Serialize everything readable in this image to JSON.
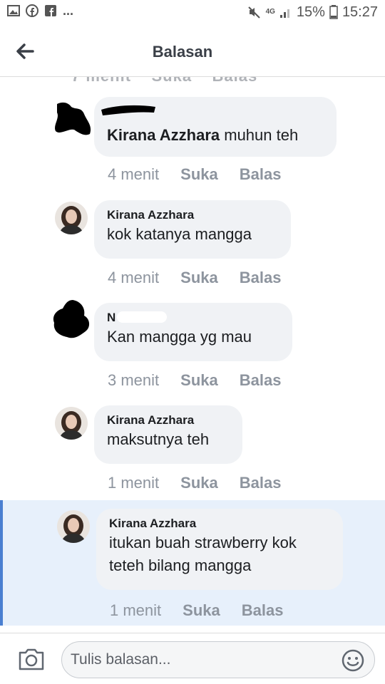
{
  "status_bar": {
    "left_dots": "...",
    "network": "4G",
    "battery": "15%",
    "time": "15:27"
  },
  "header": {
    "title": "Balasan"
  },
  "comments": [
    {
      "author": "",
      "inline_author": "Kirana Azzhara",
      "text": "muhun teh",
      "time": "4 menit",
      "like": "Suka",
      "reply": "Balas"
    },
    {
      "author": "Kirana Azzhara",
      "text": "kok katanya mangga",
      "time": "4 menit",
      "like": "Suka",
      "reply": "Balas"
    },
    {
      "author": "N",
      "text": "Kan mangga yg mau",
      "time": "3 menit",
      "like": "Suka",
      "reply": "Balas"
    },
    {
      "author": "Kirana Azzhara",
      "text": "maksutnya teh",
      "time": "1 menit",
      "like": "Suka",
      "reply": "Balas"
    },
    {
      "author": "Kirana Azzhara",
      "text_line1": "itukan buah strawberry kok",
      "text_line2": "teteh bilang mangga",
      "time": "1 menit",
      "like": "Suka",
      "reply": "Balas"
    }
  ],
  "composer": {
    "placeholder": "Tulis balasan..."
  },
  "colors": {
    "accent": "#4a7fd1",
    "bubble": "#f0f2f5",
    "highlight": "#e7f0fb"
  }
}
